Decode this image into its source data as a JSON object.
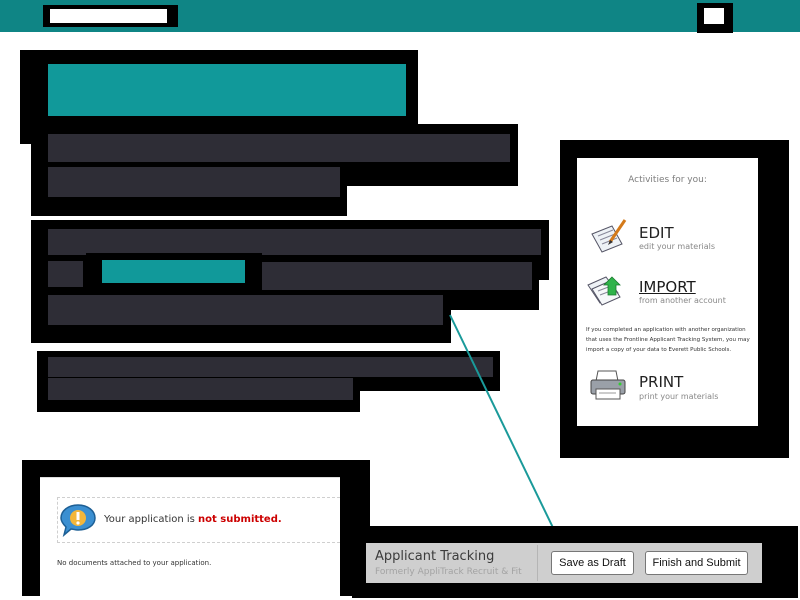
{
  "activities": {
    "title": "Activities for you:",
    "edit": {
      "label": "EDIT",
      "sub": "edit your materials"
    },
    "import": {
      "label": "IMPORT",
      "sub": "from another account"
    },
    "note": "If you completed an application with another organization that uses the Frontline Applicant Tracking System, you may import a copy of your data to Everett Public Schools.",
    "print": {
      "label": "PRINT",
      "sub": "print your materials"
    }
  },
  "status": {
    "prefix": "Your application is ",
    "state": "not submitted.",
    "no_docs": "No documents attached to your application."
  },
  "tracking": {
    "title": "Applicant Tracking",
    "subtitle": "Formerly AppliTrack Recruit & Fit",
    "save_label": "Save as Draft",
    "submit_label": "Finish and Submit"
  },
  "colors": {
    "header": "#0f8585",
    "teal": "#11999a",
    "redacted": "#2e2d36",
    "alert": "#cc0000"
  }
}
